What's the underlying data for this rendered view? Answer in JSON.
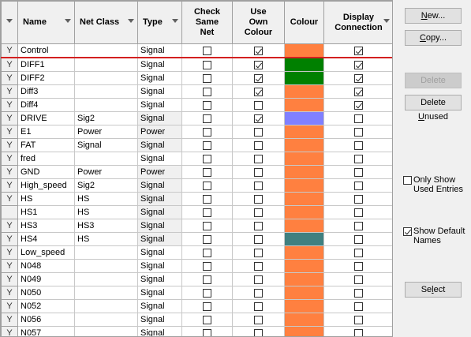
{
  "headers": {
    "name": "Name",
    "net_class": "Net Class",
    "type": "Type",
    "check_same_net": [
      "Check",
      "Same",
      "Net"
    ],
    "use_own_colour": [
      "Use",
      "Own",
      "Colour"
    ],
    "colour": "Colour",
    "display_connection": [
      "Display",
      "Connection"
    ]
  },
  "rows": [
    {
      "flag": "Y",
      "name": "Control",
      "net_class": "",
      "type": "Signal",
      "type_equal": false,
      "check": false,
      "own": true,
      "color": "#ff8040",
      "display": true,
      "selected": true
    },
    {
      "flag": "Y",
      "name": "DIFF1",
      "net_class": "",
      "type": "Signal",
      "type_equal": false,
      "check": false,
      "own": true,
      "color": "#008000",
      "display": true
    },
    {
      "flag": "Y",
      "name": "DIFF2",
      "net_class": "",
      "type": "Signal",
      "type_equal": false,
      "check": false,
      "own": true,
      "color": "#008000",
      "display": true
    },
    {
      "flag": "Y",
      "name": "Diff3",
      "net_class": "",
      "type": "Signal",
      "type_equal": false,
      "check": false,
      "own": true,
      "color": "#ff8040",
      "display": true
    },
    {
      "flag": "Y",
      "name": "Diff4",
      "net_class": "",
      "type": "Signal",
      "type_equal": false,
      "check": false,
      "own": false,
      "color": "#ff8040",
      "display": true
    },
    {
      "flag": "Y",
      "name": "DRIVE",
      "net_class": "Sig2",
      "type": "Signal",
      "type_equal": true,
      "check": false,
      "own": true,
      "color": "#8080ff",
      "display": false
    },
    {
      "flag": "Y",
      "name": "E1",
      "net_class": "Power",
      "type": "Power",
      "type_equal": true,
      "check": false,
      "own": false,
      "color": "#ff8040",
      "display": false
    },
    {
      "flag": "Y",
      "name": "FAT",
      "net_class": "Signal",
      "type": "Signal",
      "type_equal": true,
      "check": false,
      "own": false,
      "color": "#ff8040",
      "display": false
    },
    {
      "flag": "Y",
      "name": "fred",
      "net_class": "",
      "type": "Signal",
      "type_equal": false,
      "check": false,
      "own": false,
      "color": "#ff8040",
      "display": false
    },
    {
      "flag": "Y",
      "name": "GND",
      "net_class": "Power",
      "type": "Power",
      "type_equal": true,
      "check": false,
      "own": false,
      "color": "#ff8040",
      "display": false
    },
    {
      "flag": "Y",
      "name": "High_speed",
      "net_class": "Sig2",
      "type": "Signal",
      "type_equal": true,
      "check": false,
      "own": false,
      "color": "#ff8040",
      "display": false
    },
    {
      "flag": "Y",
      "name": "HS",
      "net_class": "HS",
      "type": "Signal",
      "type_equal": true,
      "check": false,
      "own": false,
      "color": "#ff8040",
      "display": false
    },
    {
      "flag": "",
      "name": "HS1",
      "net_class": "HS",
      "type": "Signal",
      "type_equal": true,
      "check": false,
      "own": false,
      "color": "#ff8040",
      "display": false
    },
    {
      "flag": "Y",
      "name": "HS3",
      "net_class": "HS3",
      "type": "Signal",
      "type_equal": true,
      "check": false,
      "own": false,
      "color": "#ff8040",
      "display": false
    },
    {
      "flag": "Y",
      "name": "HS4",
      "net_class": "HS",
      "type": "Signal",
      "type_equal": true,
      "check": false,
      "own": false,
      "color": "#408080",
      "display": false
    },
    {
      "flag": "Y",
      "name": "Low_speed",
      "net_class": "",
      "type": "Signal",
      "type_equal": false,
      "check": false,
      "own": false,
      "color": "#ff8040",
      "display": false
    },
    {
      "flag": "Y",
      "name": "N048",
      "net_class": "",
      "type": "Signal",
      "type_equal": false,
      "check": false,
      "own": false,
      "color": "#ff8040",
      "display": false
    },
    {
      "flag": "Y",
      "name": "N049",
      "net_class": "",
      "type": "Signal",
      "type_equal": false,
      "check": false,
      "own": false,
      "color": "#ff8040",
      "display": false
    },
    {
      "flag": "Y",
      "name": "N050",
      "net_class": "",
      "type": "Signal",
      "type_equal": false,
      "check": false,
      "own": false,
      "color": "#ff8040",
      "display": false
    },
    {
      "flag": "Y",
      "name": "N052",
      "net_class": "",
      "type": "Signal",
      "type_equal": false,
      "check": false,
      "own": false,
      "color": "#ff8040",
      "display": false
    },
    {
      "flag": "Y",
      "name": "N056",
      "net_class": "",
      "type": "Signal",
      "type_equal": false,
      "check": false,
      "own": false,
      "color": "#ff8040",
      "display": false
    },
    {
      "flag": "Y",
      "name": "N057",
      "net_class": "",
      "type": "Signal",
      "type_equal": false,
      "check": false,
      "own": false,
      "color": "#ff8040",
      "display": false
    }
  ],
  "buttons": {
    "new": "New...",
    "copy": "Copy...",
    "delete": "Delete",
    "delete_unused": "Delete Unused",
    "select": "Select"
  },
  "options": {
    "only_show_used": {
      "label": [
        "Only Show",
        "Used Entries"
      ],
      "checked": false
    },
    "show_default_names": {
      "label": [
        "Show Default",
        "Names"
      ],
      "checked": true
    }
  }
}
